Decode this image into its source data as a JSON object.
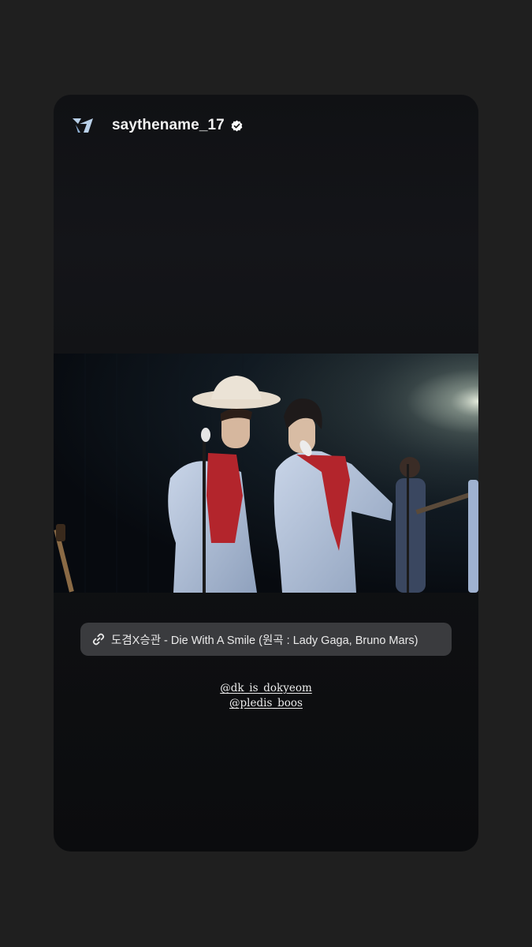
{
  "story": {
    "username": "saythename_17",
    "verified": true,
    "avatar_icon": "group-logo-icon",
    "photo_alt": "",
    "link_sticker": {
      "icon": "link-icon",
      "text": "도겸X승관 - Die With A Smile (원곡 : Lady Gaga, Bruno Mars)"
    },
    "mentions": [
      "@dk_is_dokyeom",
      "@pledis_boos"
    ]
  },
  "colors": {
    "page_background": "#1f1f1f",
    "card_background": "#0b0c0e",
    "sticker_background": "#3a3b3e",
    "suit": "#b8c6dc",
    "shirt": "#b3252c"
  }
}
